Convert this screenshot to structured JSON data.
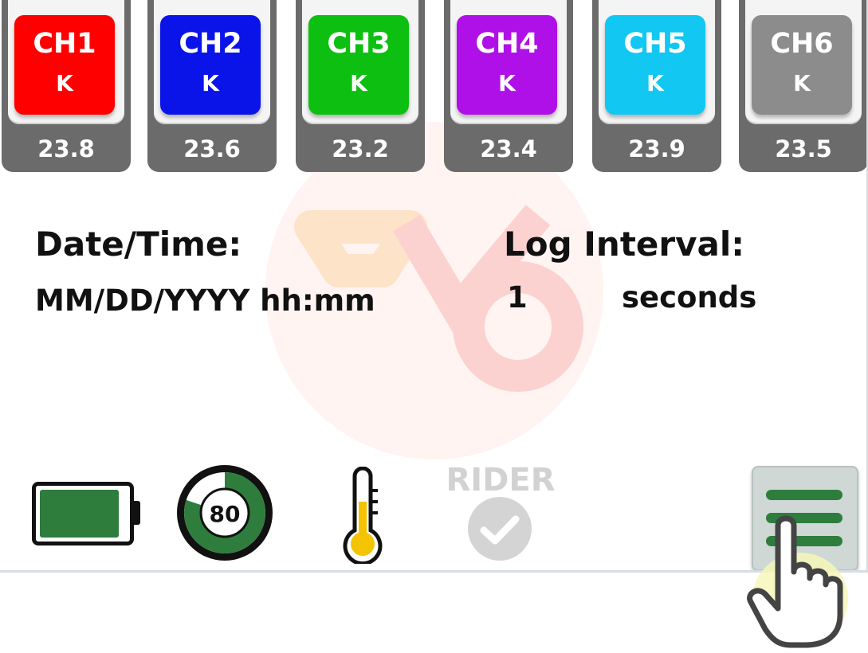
{
  "channels": [
    {
      "name": "CH1",
      "type": "K",
      "value": "23.8",
      "color": "#ff0000"
    },
    {
      "name": "CH2",
      "type": "K",
      "value": "23.6",
      "color": "#0a14e8"
    },
    {
      "name": "CH3",
      "type": "K",
      "value": "23.2",
      "color": "#0cbf10"
    },
    {
      "name": "CH4",
      "type": "K",
      "value": "23.4",
      "color": "#b010e8"
    },
    {
      "name": "CH5",
      "type": "K",
      "value": "23.9",
      "color": "#12c7f2"
    },
    {
      "name": "CH6",
      "type": "K",
      "value": "23.5",
      "color": "#8c8c8c"
    }
  ],
  "info": {
    "datetime_label": "Date/Time:",
    "datetime_value": "MM/DD/YYYY hh:mm",
    "log_label": "Log Interval:",
    "log_value": "1",
    "log_unit": "seconds"
  },
  "status": {
    "battery_icon": "battery-icon",
    "battery_level": 0.92,
    "memory_value": "80",
    "memory_fraction": 0.8,
    "rider_label": "RIDER",
    "accent": "#2e7d3d",
    "thermo_color": "#f5c400"
  },
  "menu": {
    "icon": "menu-icon"
  }
}
